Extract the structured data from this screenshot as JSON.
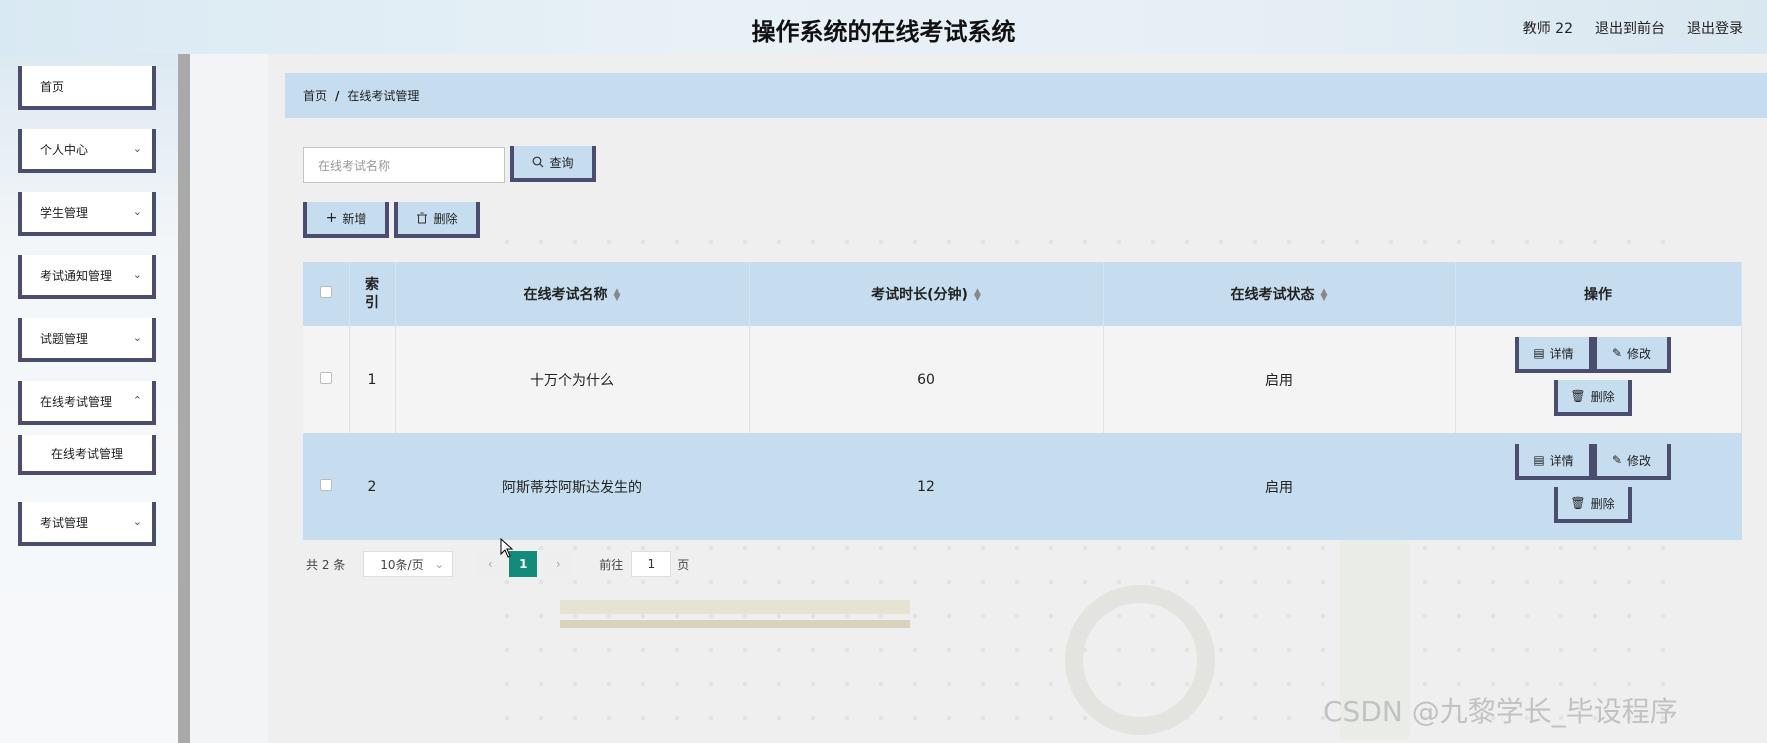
{
  "header": {
    "title": "操作系统的在线考试系统",
    "user": "教师 22",
    "to_front": "退出到前台",
    "logout": "退出登录"
  },
  "sidebar": {
    "items": [
      {
        "label": "首页"
      },
      {
        "label": "个人中心"
      },
      {
        "label": "学生管理"
      },
      {
        "label": "考试通知管理"
      },
      {
        "label": "试题管理"
      },
      {
        "label": "在线考试管理"
      },
      {
        "label": "在线考试管理"
      },
      {
        "label": "考试管理"
      }
    ]
  },
  "breadcrumb": {
    "home": "首页",
    "sep": "/",
    "current": "在线考试管理"
  },
  "search": {
    "placeholder": "在线考试名称",
    "button": "查询"
  },
  "toolbar": {
    "add": "新增",
    "delete": "删除"
  },
  "table": {
    "headers": {
      "index": "索引",
      "name": "在线考试名称",
      "duration": "考试时长(分钟)",
      "status": "在线考试状态",
      "actions": "操作"
    },
    "rows": [
      {
        "index": "1",
        "name": "十万个为什么",
        "duration": "60",
        "status": "启用"
      },
      {
        "index": "2",
        "name": "阿斯蒂芬阿斯达发生的",
        "duration": "12",
        "status": "启用"
      }
    ],
    "actions": {
      "detail": "详情",
      "edit": "修改",
      "delete": "删除"
    }
  },
  "pagination": {
    "total": "共 2 条",
    "page_size": "10条/页",
    "current": "1",
    "goto": "前往",
    "goto_value": "1",
    "page_suffix": "页"
  },
  "watermark": "CSDN @九黎学长_毕设程序",
  "colors": {
    "accent": "#c5ddee",
    "border": "#4a4d6e",
    "pager_active": "#138b7c"
  }
}
